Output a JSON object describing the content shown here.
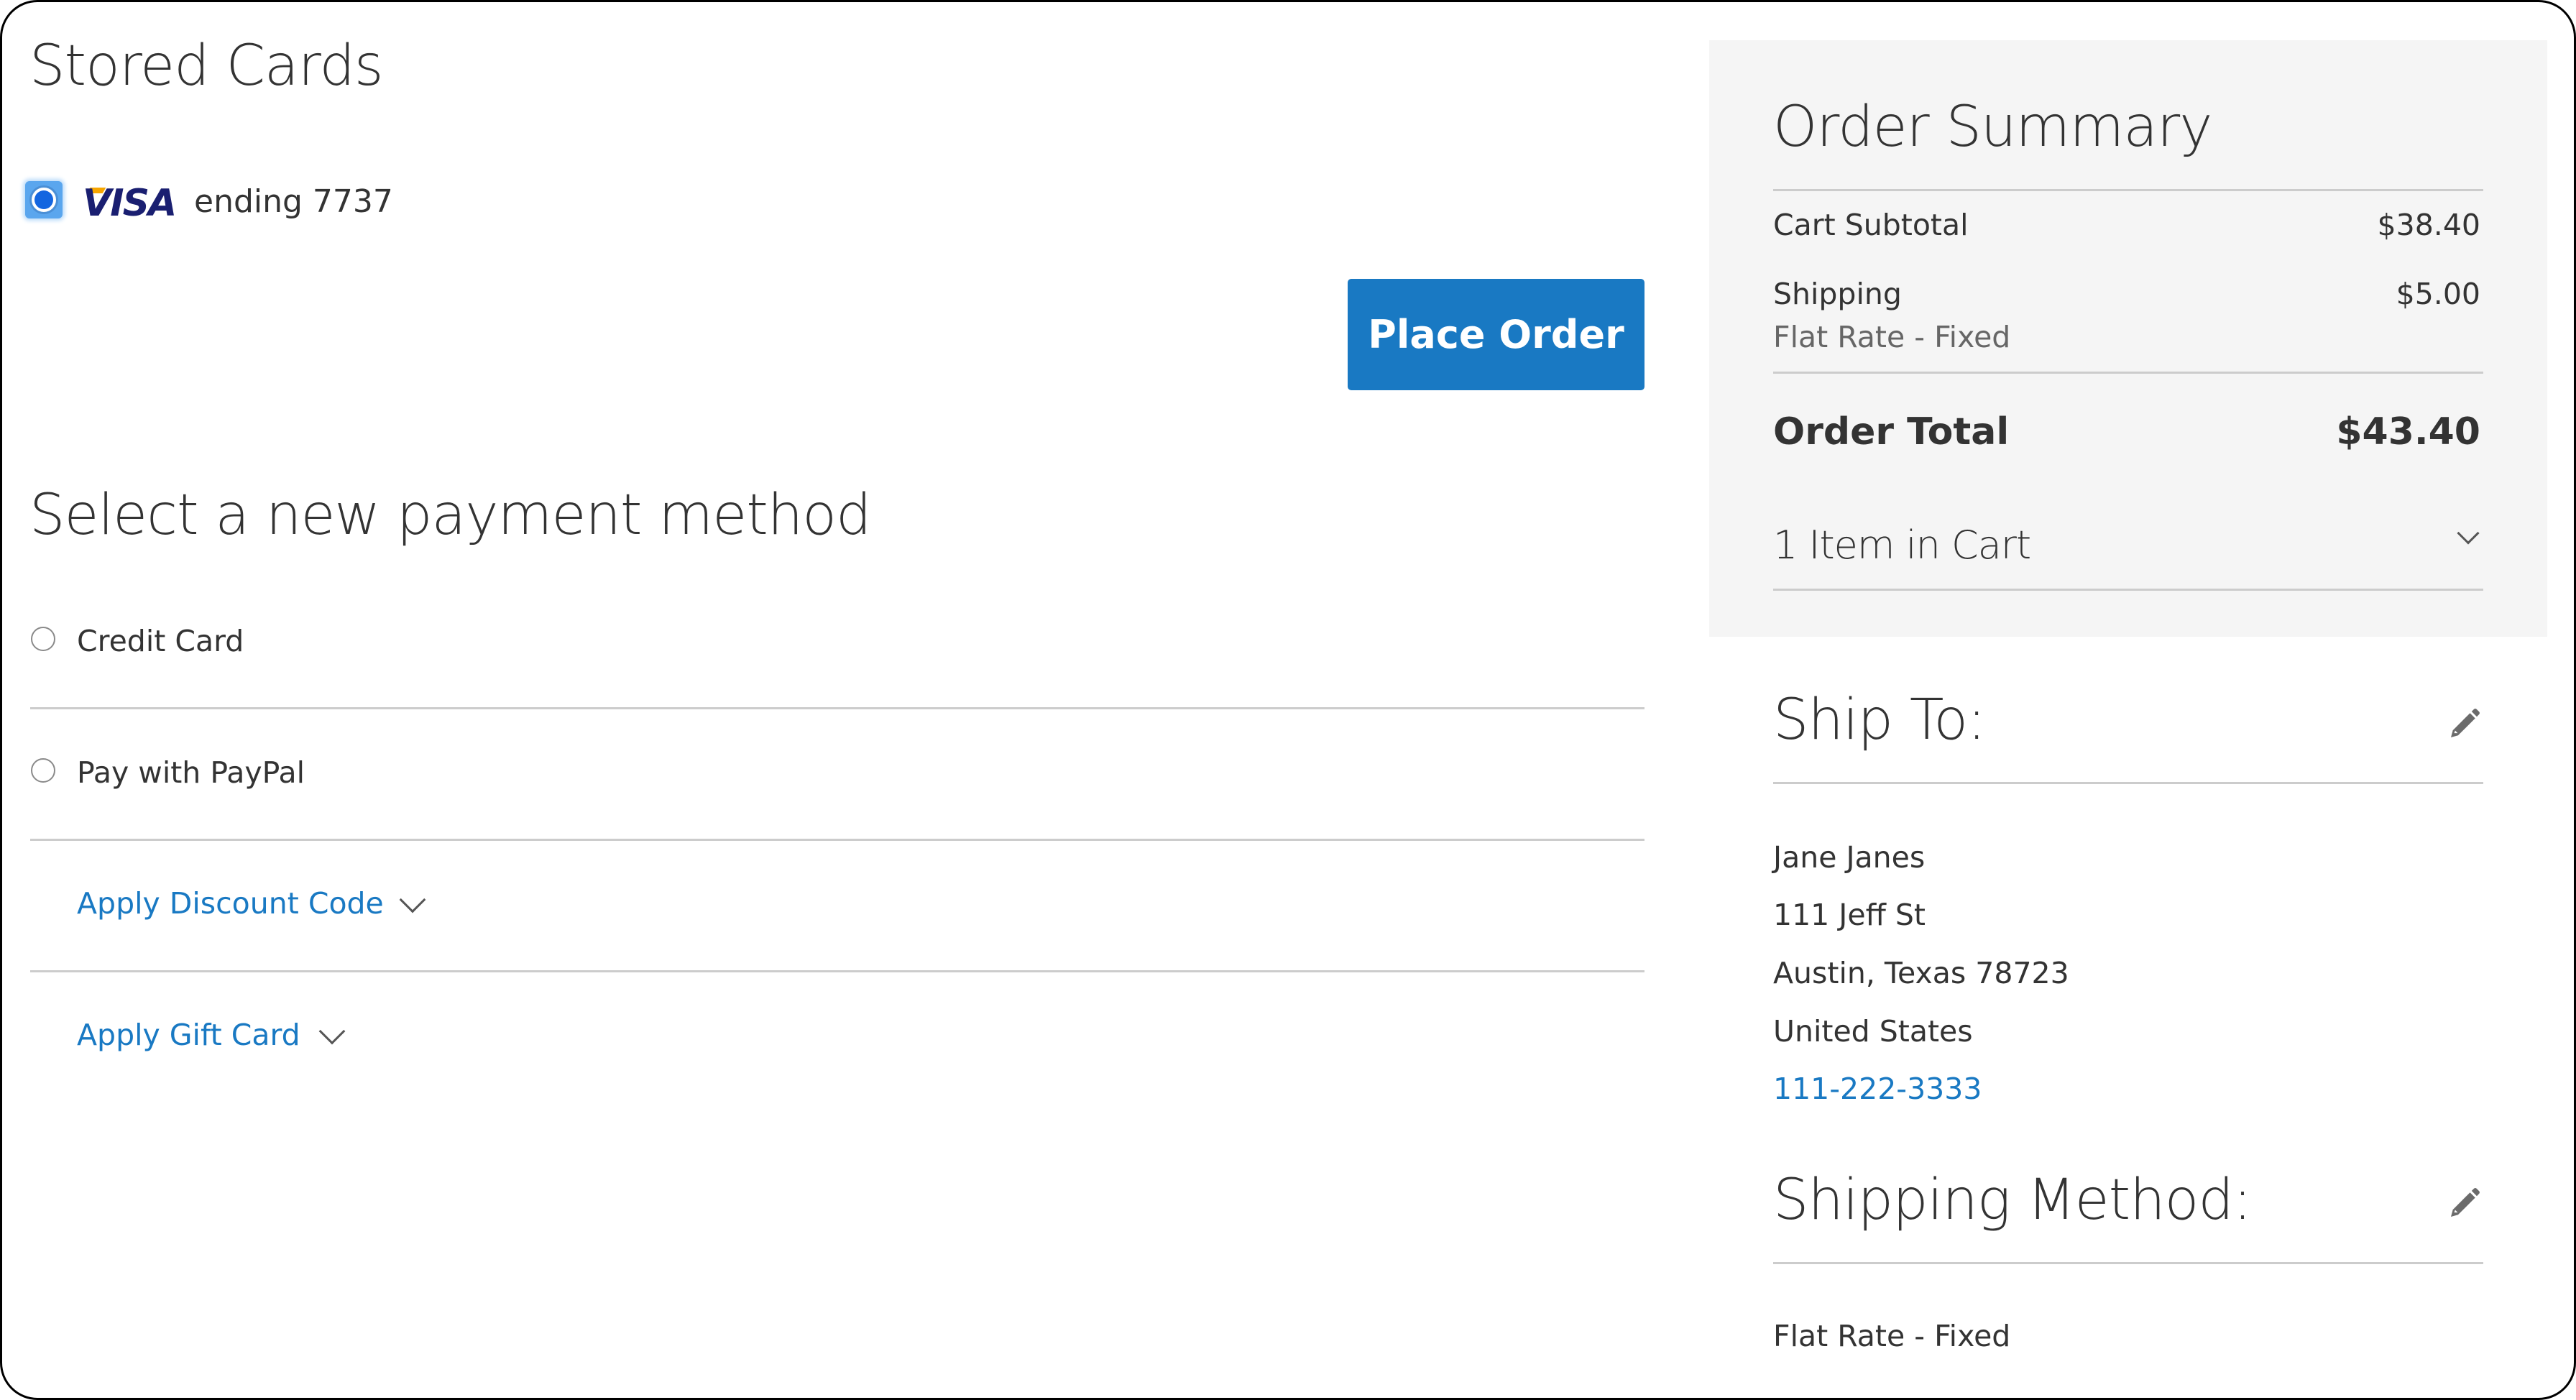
{
  "stored_cards": {
    "title": "Stored Cards",
    "cards": [
      {
        "brand": "VISA",
        "label": "ending 7737",
        "selected": true
      }
    ],
    "place_order_label": "Place Order"
  },
  "payment": {
    "title": "Select a new payment method",
    "methods": [
      {
        "label": "Credit Card",
        "selected": false
      },
      {
        "label": "Pay with PayPal",
        "selected": false
      }
    ],
    "discount_label": "Apply Discount Code",
    "gift_card_label": "Apply Gift Card"
  },
  "summary": {
    "title": "Order Summary",
    "subtotal_label": "Cart Subtotal",
    "subtotal_value": "$38.40",
    "shipping_label": "Shipping",
    "shipping_method": "Flat Rate - Fixed",
    "shipping_value": "$5.00",
    "total_label": "Order Total",
    "total_value": "$43.40",
    "items_in_cart": "1 Item in Cart"
  },
  "ship_to": {
    "title": "Ship To:",
    "name": "Jane Janes",
    "street": "111 Jeff St",
    "city_line": "Austin, Texas 78723",
    "country": "United States",
    "phone": "111-222-3333"
  },
  "shipping_method": {
    "title": "Shipping Method:",
    "value": "Flat Rate - Fixed"
  },
  "colors": {
    "primary": "#1979c3",
    "link": "#1979c3",
    "panel_bg": "#f5f5f5",
    "divider": "#cccccc",
    "text": "#333333"
  }
}
